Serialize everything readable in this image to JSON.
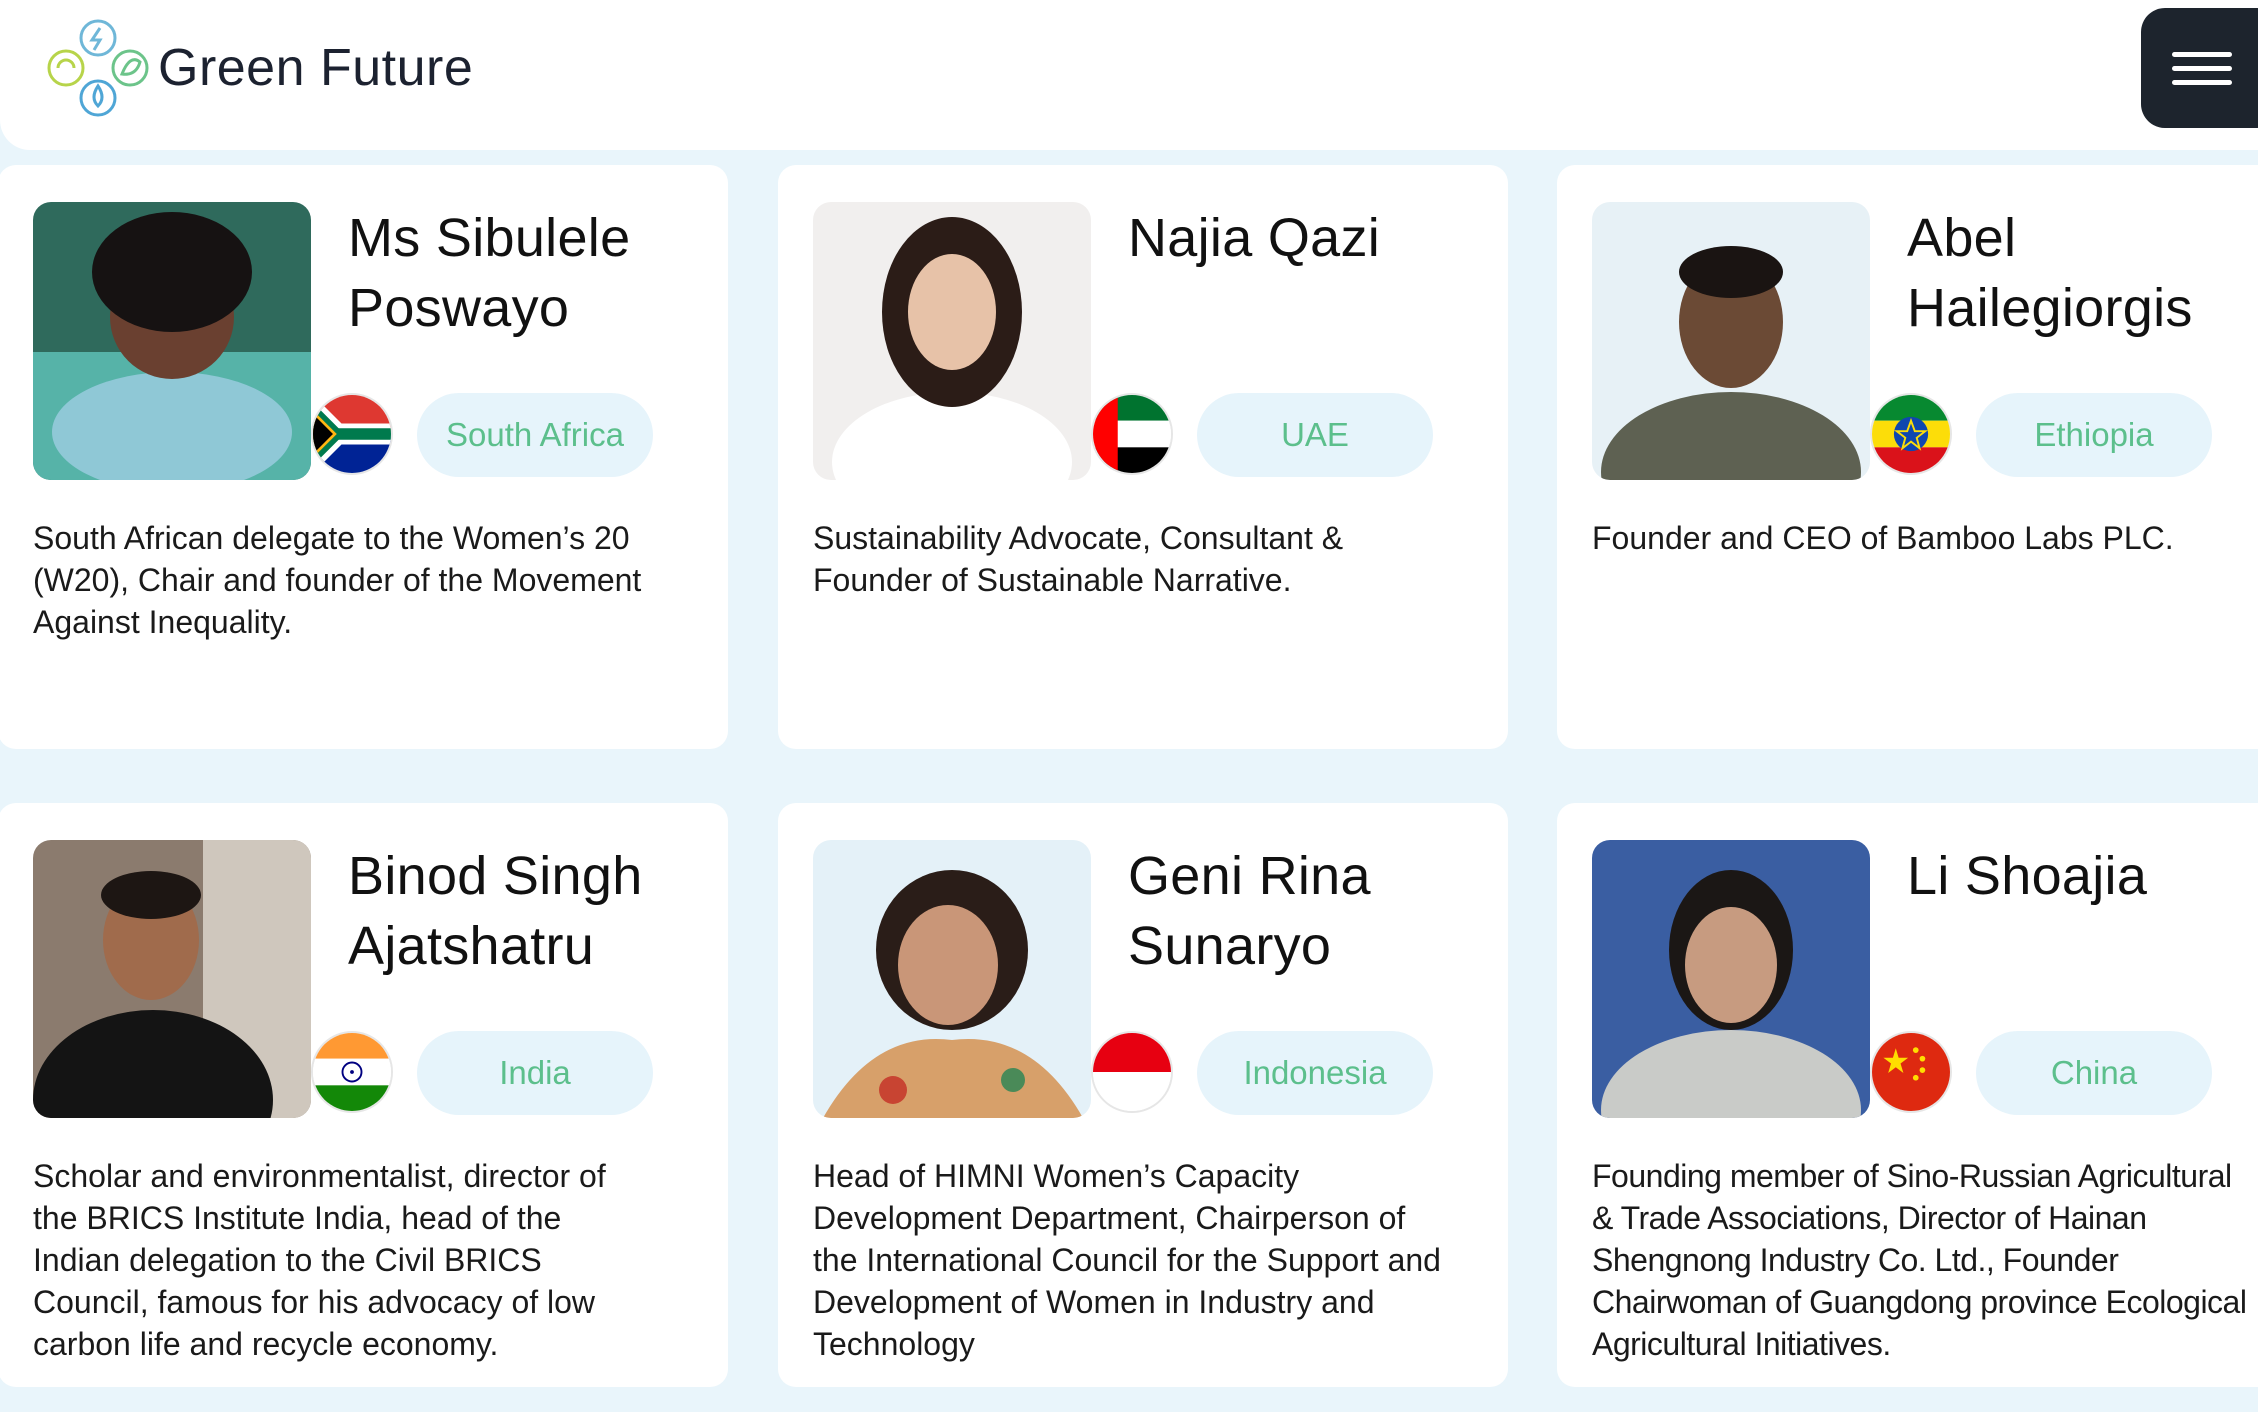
{
  "brand": {
    "name": "Green Future"
  },
  "colors": {
    "accent_green": "#5cbf8c",
    "pill_bg": "#e6f4fb",
    "menu_bg": "#1d242d",
    "page_bg": "#e9f5fb"
  },
  "header": {
    "menu_icon": "hamburger-menu-icon"
  },
  "speakers": [
    {
      "name": "Ms Sibulele Poswayo",
      "country": "South Africa",
      "flag": "south-africa-flag-icon",
      "description": "South African delegate to the Women’s 20 (W20), Chair and founder of the Movement Against Inequality."
    },
    {
      "name": "Najia Qazi",
      "country": "UAE",
      "flag": "uae-flag-icon",
      "description": "Sustainability Advocate, Consultant & Founder of Sustainable Narrative."
    },
    {
      "name": "Abel Hailegiorgis",
      "country": "Ethiopia",
      "flag": "ethiopia-flag-icon",
      "description": "Founder and CEO of Bamboo Labs PLC."
    },
    {
      "name": "Binod Singh Ajatshatru",
      "country": "India",
      "flag": "india-flag-icon",
      "description": "Scholar and environmentalist, director of the BRICS Institute India, head of the Indian delegation to the Civil BRICS Council, famous for his advocacy of low carbon life and recycle economy."
    },
    {
      "name": "Geni Rina Sunaryo",
      "country": "Indonesia",
      "flag": "indonesia-flag-icon",
      "description": "Head of HIMNI Women’s Capacity Development Department, Chairperson of the International Council for the Support and Development of Women in Industry and Technology"
    },
    {
      "name": "Li Shoajia",
      "country": "China",
      "flag": "china-flag-icon",
      "description": "Founding member of Sino-Russian Agricultural & Trade Associations, Director of Hainan Shengnong Industry Co. Ltd., Founder Chairwoman of Guangdong province Ecological Agricultural Initiatives."
    }
  ]
}
